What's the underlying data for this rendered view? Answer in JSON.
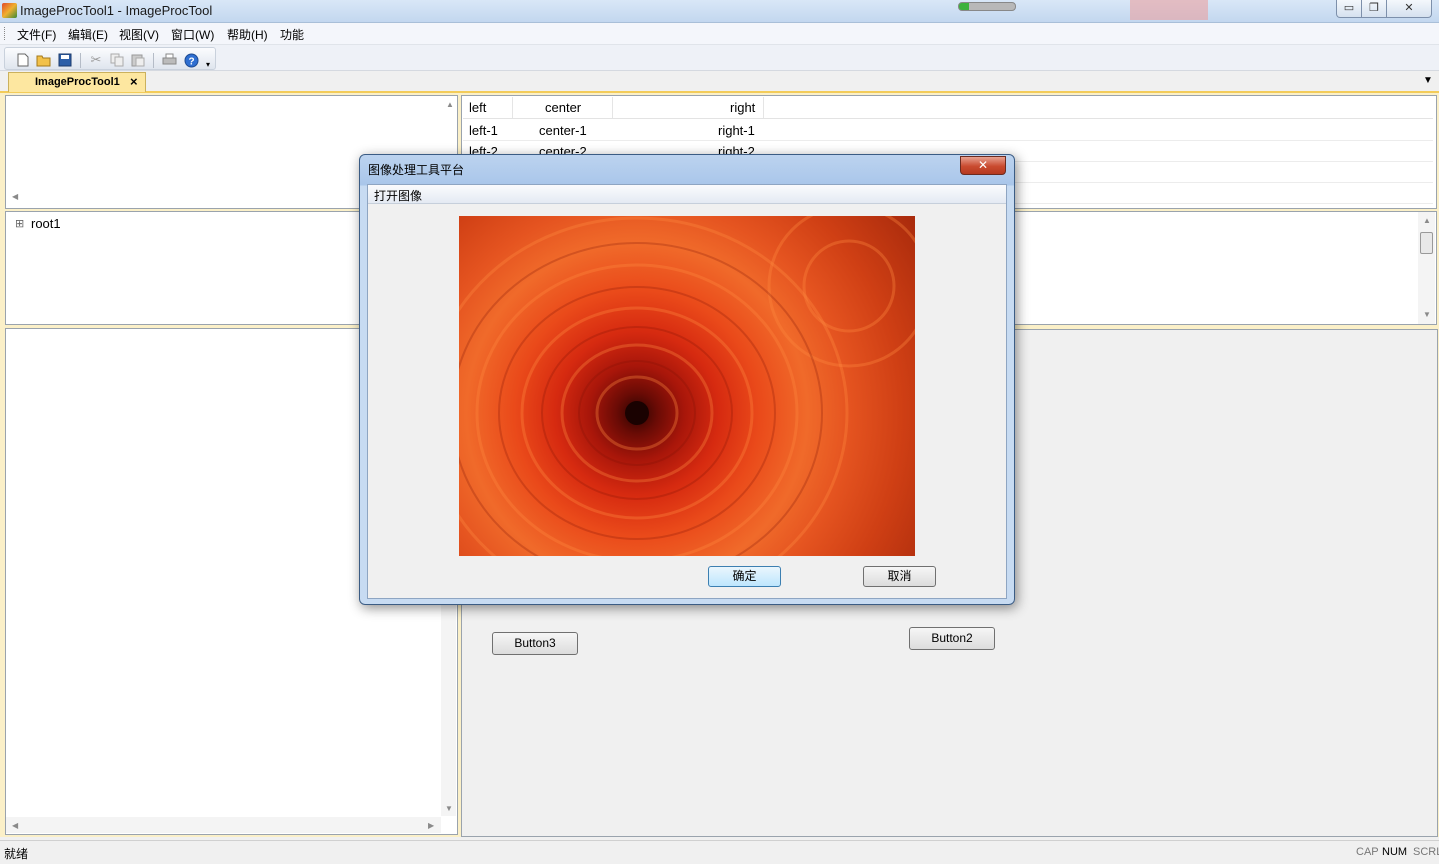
{
  "window": {
    "title": "ImageProcTool1 - ImageProcTool",
    "min_glyph": "▭",
    "max_glyph": "❐",
    "close_glyph": "✕"
  },
  "menu": {
    "items": [
      "文件(F)",
      "编辑(E)",
      "视图(V)",
      "窗口(W)",
      "帮助(H)",
      "功能"
    ]
  },
  "toolbar": {
    "icons": [
      "new-file-icon",
      "open-folder-icon",
      "save-icon",
      "cut-icon",
      "copy-icon",
      "paste-icon",
      "print-icon",
      "help-icon",
      "toolbar-options-icon"
    ]
  },
  "tabs": {
    "doc_tab_label": "ImageProcTool1",
    "close_glyph": "×"
  },
  "tree": {
    "root_label": "root1",
    "expand_glyph": "⊞"
  },
  "list": {
    "columns": [
      "left",
      "center",
      "right"
    ],
    "rows": [
      [
        "left-1",
        "center-1",
        "right-1"
      ],
      [
        "left-2",
        "center-2",
        "right-2"
      ]
    ]
  },
  "form": {
    "button3_label": "Button3",
    "button2_label": "Button2"
  },
  "status": {
    "text": "就绪",
    "cap": "CAP",
    "num": "NUM",
    "scrl": "SCRL"
  },
  "dialog": {
    "title": "图像处理工具平台",
    "close_glyph": "✕",
    "menu_item": "打开图像",
    "ok_label": "确定",
    "cancel_label": "取消"
  },
  "colors": {
    "workspace_bg": "#fbf0c8",
    "tab_accent": "#fde7a0",
    "dialog_frame": "#c7dbf2",
    "dialog_close": "#c94a2f"
  }
}
